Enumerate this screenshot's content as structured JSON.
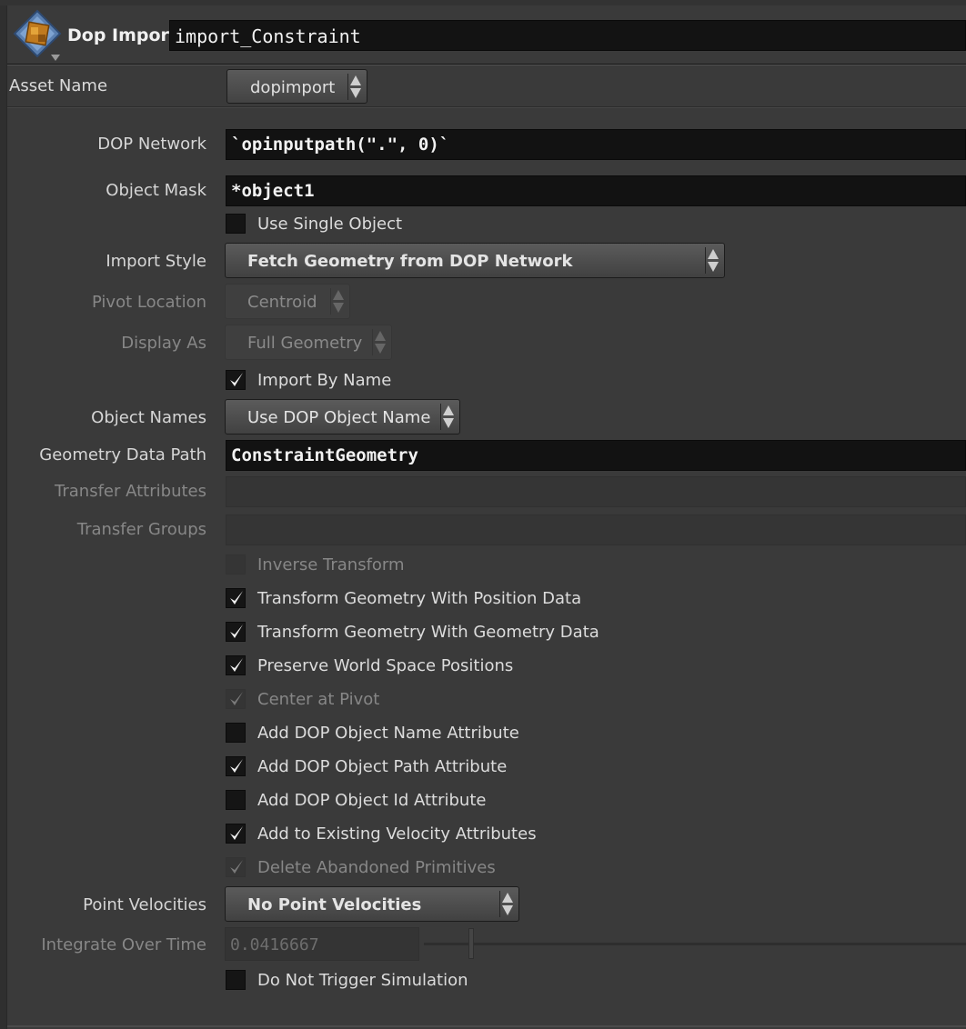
{
  "header": {
    "node_type": "Dop Import",
    "node_name": "import_Constraint",
    "icon": "dop-import-node-icon"
  },
  "asset": {
    "label": "Asset Name",
    "value": "dopimport"
  },
  "params": {
    "dop_network": {
      "label": "DOP Network",
      "value": "`opinputpath(\".\", 0)`"
    },
    "object_mask": {
      "label": "Object Mask",
      "value": "*object1"
    },
    "use_single_object": {
      "label": "Use Single Object",
      "checked": false
    },
    "import_style": {
      "label": "Import Style",
      "value": "Fetch Geometry from DOP Network"
    },
    "pivot_location": {
      "label": "Pivot Location",
      "value": "Centroid",
      "disabled": true
    },
    "display_as": {
      "label": "Display As",
      "value": "Full Geometry",
      "disabled": true
    },
    "import_by_name": {
      "label": "Import By Name",
      "checked": true
    },
    "object_names": {
      "label": "Object Names",
      "value": "Use DOP Object Name"
    },
    "geometry_data_path": {
      "label": "Geometry Data Path",
      "value": "ConstraintGeometry"
    },
    "transfer_attributes": {
      "label": "Transfer Attributes",
      "value": "",
      "disabled": true
    },
    "transfer_groups": {
      "label": "Transfer Groups",
      "value": "",
      "disabled": true
    },
    "point_velocities": {
      "label": "Point Velocities",
      "value": "No Point Velocities"
    },
    "integrate_over_time": {
      "label": "Integrate Over Time",
      "value": "0.0416667",
      "disabled": true
    },
    "do_not_trigger": {
      "label": "Do Not Trigger Simulation",
      "checked": false
    }
  },
  "toggles": [
    {
      "label": "Inverse Transform",
      "checked": false,
      "disabled": true
    },
    {
      "label": "Transform Geometry With Position Data",
      "checked": true,
      "disabled": false
    },
    {
      "label": "Transform Geometry With Geometry Data",
      "checked": true,
      "disabled": false
    },
    {
      "label": "Preserve World Space Positions",
      "checked": true,
      "disabled": false
    },
    {
      "label": "Center at Pivot",
      "checked": true,
      "disabled": true
    },
    {
      "label": "Add DOP Object Name Attribute",
      "checked": false,
      "disabled": false
    },
    {
      "label": "Add DOP Object Path Attribute",
      "checked": true,
      "disabled": false
    },
    {
      "label": "Add DOP Object Id Attribute",
      "checked": false,
      "disabled": false
    },
    {
      "label": "Add to Existing Velocity Attributes",
      "checked": true,
      "disabled": false
    },
    {
      "label": "Delete Abandoned Primitives",
      "checked": true,
      "disabled": true
    }
  ],
  "colors": {
    "background": "#3a3a3a",
    "field": "#121212",
    "checkmark": "#f0f0f0",
    "disabled_text": "#878787"
  }
}
